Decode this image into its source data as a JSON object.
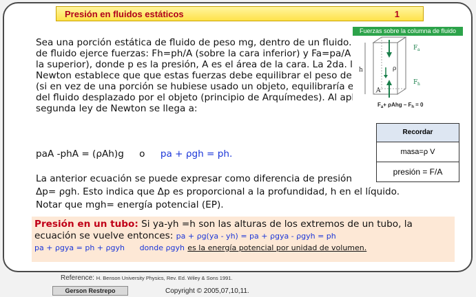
{
  "slide": {
    "title": "Presión en fluidos estáticos",
    "page": "1"
  },
  "figure": {
    "title": "Fuerzas sobre la columna de fluido",
    "label_h": "h",
    "label_A": "A",
    "label_Fa": "F",
    "sub_a": "a",
    "label_Fh": "F",
    "sub_h": "h",
    "label_rho": "ρ",
    "equation": "F",
    "equation_rest": "+ ρAhg – F",
    "equation_tail": "= 0"
  },
  "text": {
    "paragraph1": "Sea una porción estática de fluido de peso mg, dentro de un fluido. El resto de fluido ejerce fuerzas: Fh=ph/A (sobre la cara inferior) y Fa=pa/A (sobre la superior), donde p es la presión, A es el área de la cara. La 2da. ley de Newton establece que que estas fuerzas debe equilibrar el peso del fluido (si en vez de una porción se hubiese usado un objeto, equilibraría el peso del fluido desplazado por el objeto (principio de Arquímedes). Al aplicar la segunda ley de Newton se llega a:",
    "eq_left": "paA   -phA = (ρAh)g",
    "eq_or": "o",
    "eq_right": "pa + ρgh = ph.",
    "paragraph2a": "La anterior ecuación se puede expresar como diferencia de presión",
    "paragraph2b": "Δp= ρgh. Esto indica que Δp es proporcional a la profundidad, h en el líquido.",
    "paragraph2c": "Notar que mgh= energía potencial (EP)."
  },
  "remember": {
    "header": "Recordar",
    "row1": "masa=ρ V",
    "row2": "presión = F/A"
  },
  "tube": {
    "label": "Presión en un tubo:",
    "line1": " Si ya-yh =h son las alturas de los extremos de un tubo, la",
    "line2": "ecuación se vuelve entonces:",
    "line2_eq": "pa + ρg(ya - yh) =  pa + ρgya  - ρgyh = ph",
    "line3_eq": "pa + ρgya = ph  + ρgyh",
    "line3_donde": "donde ρgyh",
    "line3_tail": "es la energía potencial por unidad de volumen."
  },
  "footer": {
    "reference_label": "Reference:",
    "reference": "H. Benson University Physics, Rev. Ed. Wiley & Sons 1991.",
    "author": "Gerson Restrepo",
    "copyright": "Copyright © 2005,07,10,11."
  },
  "colors": {
    "title": "#b0001a",
    "equation_blue": "#1a35d8",
    "figure_header": "#2ca34a",
    "highlight_box": "#fde8d6"
  }
}
